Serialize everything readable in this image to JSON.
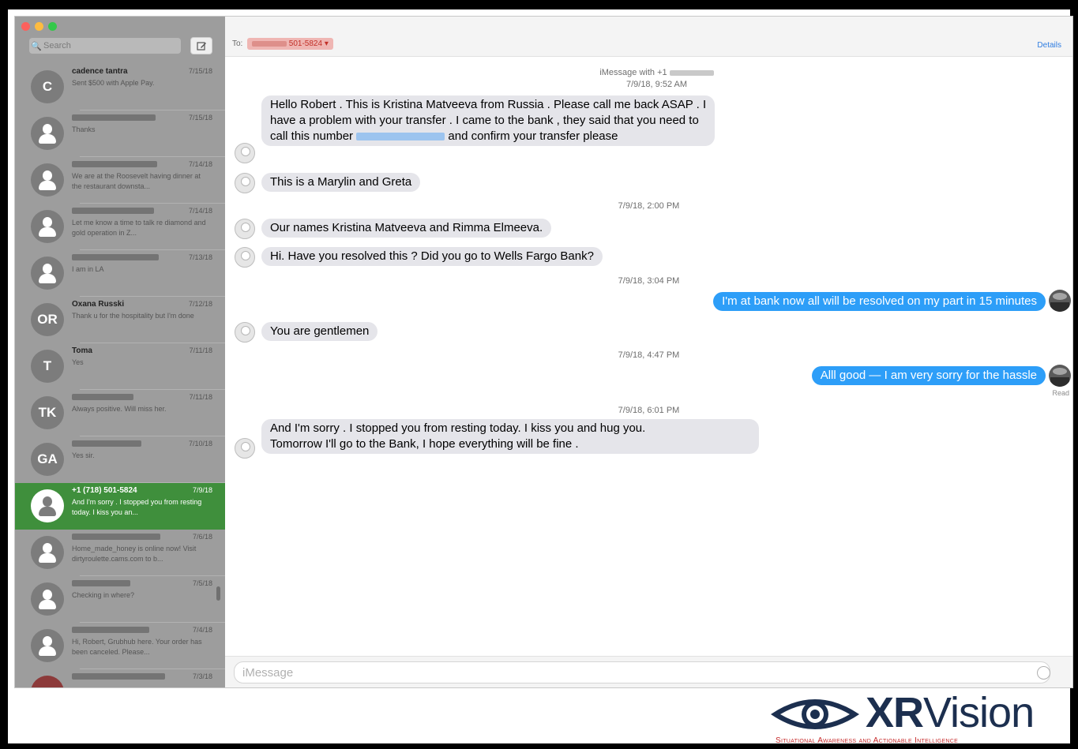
{
  "window": {
    "traffic_lights": [
      {
        "name": "close",
        "color": "#fc615d"
      },
      {
        "name": "minimize",
        "color": "#fdbc40"
      },
      {
        "name": "zoom",
        "color": "#34c84a"
      }
    ]
  },
  "sidebar": {
    "search_placeholder": "Search",
    "conversations": [
      {
        "name": "cadence tantra",
        "date": "7/15/18",
        "preview": "Sent $500 with Apple Pay.",
        "avatar": "C"
      },
      {
        "name": "",
        "date": "7/15/18",
        "preview": "Thanks",
        "avatar": ""
      },
      {
        "name": "",
        "date": "7/14/18",
        "preview": "We are at the Roosevelt having dinner at the restaurant downsta...",
        "avatar": ""
      },
      {
        "name": "",
        "date": "7/14/18",
        "preview": "Let me know a time to talk re diamond and gold operation in Z...",
        "avatar": ""
      },
      {
        "name": "",
        "date": "7/13/18",
        "preview": "I am in LA",
        "avatar": ""
      },
      {
        "name": "Oxana Russki",
        "date": "7/12/18",
        "preview": "Thank u for the hospitality but I'm done",
        "avatar": "OR"
      },
      {
        "name": "Toma",
        "date": "7/11/18",
        "preview": "Yes",
        "avatar": "T"
      },
      {
        "name": "",
        "date": "7/11/18",
        "preview": "Always positive. Will miss her.",
        "avatar": "TK"
      },
      {
        "name": "",
        "date": "7/10/18",
        "preview": "Yes sir.",
        "avatar": "GA"
      },
      {
        "name": "+1 (718) 501-5824",
        "date": "7/9/18",
        "preview": "And I'm sorry . I stopped you from resting today. I kiss you an...",
        "avatar": "",
        "selected": true
      },
      {
        "name": "",
        "date": "7/6/18",
        "preview": "Home_made_honey is online now! Visit dirtyroulette.cams.com to b...",
        "avatar": ""
      },
      {
        "name": "",
        "date": "7/5/18",
        "preview": "Checking in where?",
        "avatar": ""
      },
      {
        "name": "",
        "date": "7/4/18",
        "preview": "Hi, Robert, Grubhub here. Your order has been canceled. Please...",
        "avatar": ""
      },
      {
        "name": "",
        "date": "7/3/18",
        "preview": "",
        "avatar": ""
      }
    ]
  },
  "header": {
    "to_label": "To:",
    "recipient_suffix": "501-5824",
    "details_label": "Details"
  },
  "chat": {
    "header_line": "iMessage with +1",
    "header_time": "7/9/18, 9:52 AM",
    "timestamps": [
      "7/9/18, 2:00 PM",
      "7/9/18, 3:04 PM",
      "7/9/18, 4:47 PM",
      "7/9/18, 6:01 PM"
    ],
    "messages": [
      {
        "dir": "in",
        "lines": [
          "Hello Robert . This is Kristina Matveeva from Russia . Please call me back ASAP . I",
          "have a problem with your transfer . I came to the bank , they said that you need to"
        ],
        "line3_before": "call this number",
        "line3_link": "",
        "line3_after": "and confirm your transfer please"
      },
      {
        "dir": "in",
        "text": "This is a Marylin and Greta"
      },
      {
        "dir": "in",
        "text": "Our names Kristina Matveeva and Rimma Elmeeva."
      },
      {
        "dir": "in",
        "text": "Hi. Have you resolved this ? Did you go to Wells Fargo Bank?"
      },
      {
        "dir": "out",
        "text": "I'm at bank now all will be resolved on my part in 15 minutes"
      },
      {
        "dir": "in",
        "text": "You are gentlemen"
      },
      {
        "dir": "out",
        "text": "Alll good — I am very sorry for the hassle"
      },
      {
        "dir": "in",
        "lines": [
          "And I'm sorry . I stopped you from resting today. I kiss you and hug you.",
          "Tomorrow I'll go to the Bank, I hope everything will be fine ."
        ]
      }
    ],
    "read_receipt": "Read"
  },
  "composer": {
    "placeholder": "iMessage"
  },
  "logo": {
    "word_bold": "XR",
    "word_light": "Vision",
    "tagline": "Situational Awareness and Actionable Intelligence"
  }
}
